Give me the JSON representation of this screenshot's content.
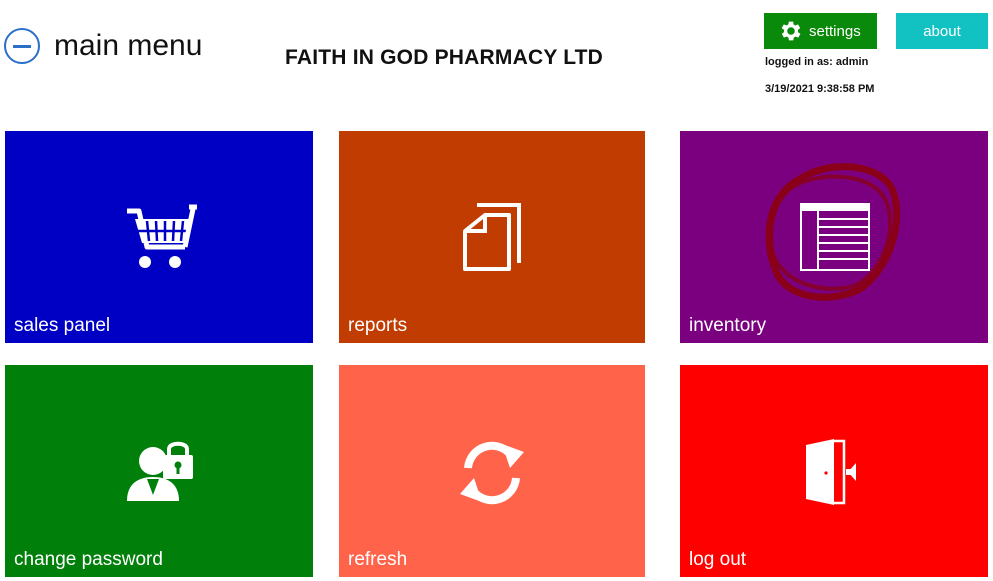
{
  "header": {
    "title": "main menu",
    "company_name": "FAITH IN GOD PHARMACY LTD",
    "settings_label": "settings",
    "about_label": "about",
    "logged_in_text": "logged in as: admin",
    "datetime": "3/19/2021 9:38:58 PM"
  },
  "tiles": [
    {
      "label": "sales panel",
      "color": "#0000c4",
      "icon": "shopping-cart-icon"
    },
    {
      "label": "reports",
      "color": "#c13c00",
      "icon": "documents-icon"
    },
    {
      "label": "inventory",
      "color": "#7a0080",
      "icon": "table-icon"
    },
    {
      "label": "change password",
      "color": "#00800a",
      "icon": "user-lock-icon"
    },
    {
      "label": "refresh",
      "color": "#ff634a",
      "icon": "refresh-icon"
    },
    {
      "label": "log out",
      "color": "#ff0000",
      "icon": "exit-door-icon"
    }
  ],
  "colors": {
    "settings_bg": "#0a8a0a",
    "about_bg": "#12c2c2",
    "back_icon": "#2a6fc9"
  }
}
